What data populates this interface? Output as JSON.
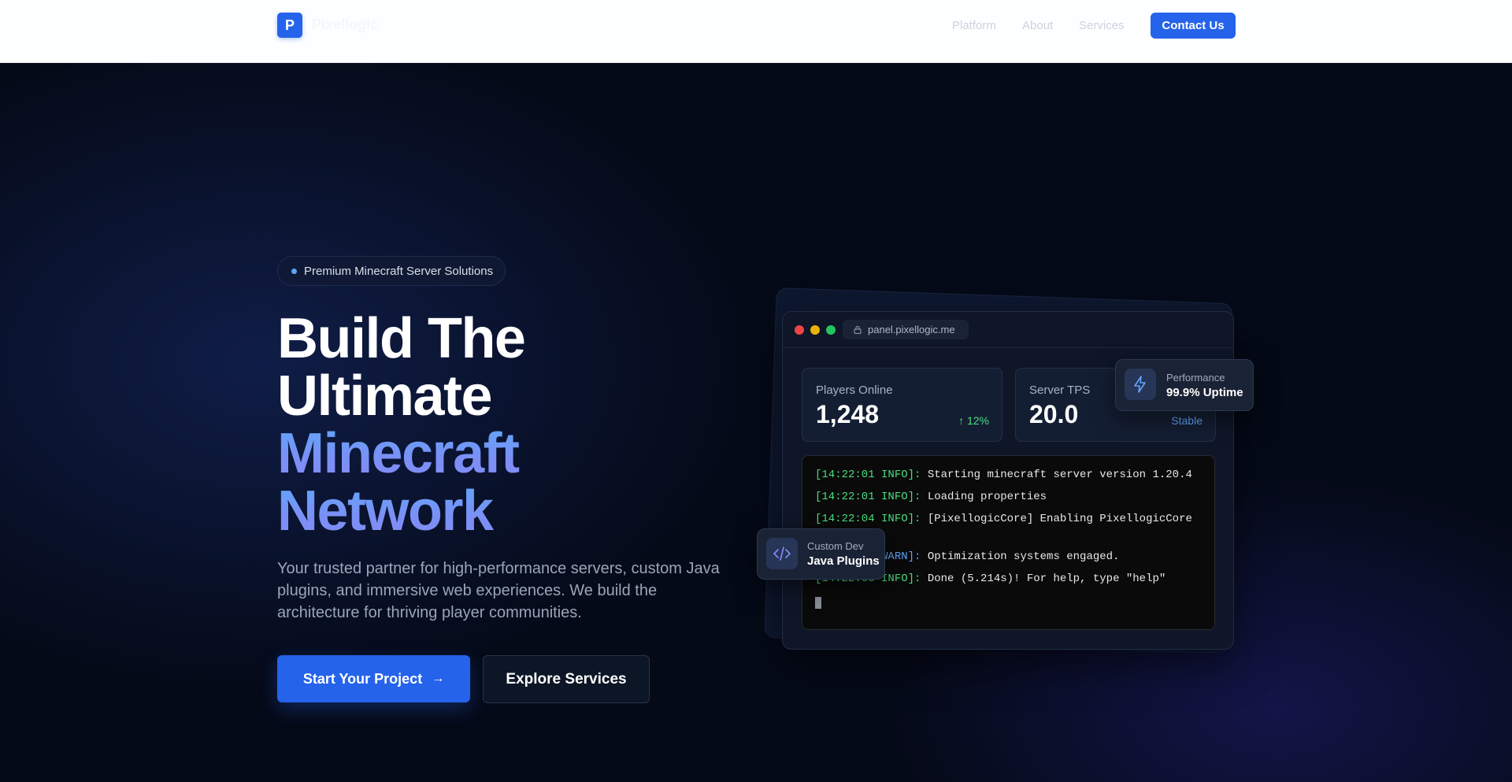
{
  "header": {
    "logo_letter": "P",
    "brand": "Pixellogic",
    "nav": [
      "Platform",
      "About",
      "Services"
    ],
    "contact_label": "Contact Us"
  },
  "hero": {
    "badge": "Premium Minecraft Server Solutions",
    "headline_line1": "Build The",
    "headline_line2": "Ultimate",
    "headline_line3": "Minecraft",
    "headline_line4": "Network",
    "description": "Your trusted partner for high-performance servers, custom Java plugins, and immersive web experiences. We build the architecture for thriving player communities.",
    "primary_cta": "Start Your Project",
    "secondary_cta": "Explore Services"
  },
  "dashboard": {
    "url": "panel.pixellogic.me",
    "stats": [
      {
        "label": "Players Online",
        "value": "1,248",
        "trend": "↑ 12%"
      },
      {
        "label": "Server TPS",
        "value": "20.0",
        "trend": "Stable"
      }
    ],
    "console": [
      {
        "tag": "[14:22:01 INFO]:",
        "text": "Starting minecraft server version 1.20.4"
      },
      {
        "tag": "[14:22:01 INFO]:",
        "text": "Loading properties"
      },
      {
        "tag": "[14:22:04 INFO]:",
        "text": "[PixellogicCore] Enabling PixellogicCore"
      },
      {
        "tag": "[14:22:05 WARN]:",
        "text": "Optimization systems engaged."
      },
      {
        "tag": "[14:22:05 INFO]:",
        "text": "Done (5.214s)! For help, type \"help\""
      }
    ],
    "float_performance": {
      "small": "Performance",
      "big": "99.9% Uptime"
    },
    "float_dev": {
      "small": "Custom Dev",
      "big": "Java Plugins"
    }
  },
  "colors": {
    "accent": "#2563eb",
    "gradient_start": "#60a5fa",
    "gradient_end": "#818cf8",
    "success": "#4ade80",
    "background": "#050a18"
  }
}
